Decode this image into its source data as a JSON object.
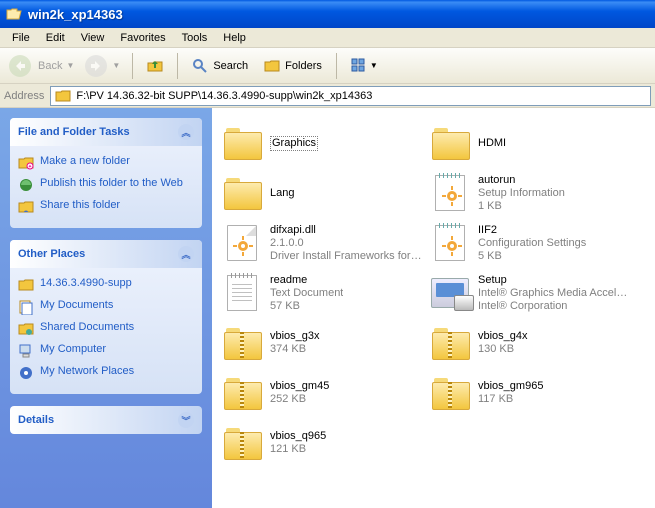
{
  "window": {
    "title": "win2k_xp14363"
  },
  "menu": {
    "file": "File",
    "edit": "Edit",
    "view": "View",
    "favorites": "Favorites",
    "tools": "Tools",
    "help": "Help"
  },
  "toolbar": {
    "back": "Back",
    "search": "Search",
    "folders": "Folders"
  },
  "address": {
    "label": "Address",
    "path": "F:\\PV 14.36.32-bit SUPP\\14.36.3.4990-supp\\win2k_xp14363"
  },
  "panels": {
    "tasks": {
      "title": "File and Folder Tasks",
      "items": [
        {
          "label": "Make a new folder"
        },
        {
          "label": "Publish this folder to the Web"
        },
        {
          "label": "Share this folder"
        }
      ]
    },
    "places": {
      "title": "Other Places",
      "items": [
        {
          "label": "14.36.3.4990-supp"
        },
        {
          "label": "My Documents"
        },
        {
          "label": "Shared Documents"
        },
        {
          "label": "My Computer"
        },
        {
          "label": "My Network Places"
        }
      ]
    },
    "details": {
      "title": "Details"
    }
  },
  "files": [
    {
      "name": "Graphics",
      "type": "folder",
      "selected": true
    },
    {
      "name": "Lang",
      "type": "folder"
    },
    {
      "name": "difxapi.dll",
      "type": "dll",
      "sub1": "2.1.0.0",
      "sub2": "Driver Install Frameworks for ..."
    },
    {
      "name": "readme",
      "type": "txt",
      "sub1": "Text Document",
      "sub2": "57 KB"
    },
    {
      "name": "vbios_g3x",
      "type": "zip",
      "sub1": "374 KB"
    },
    {
      "name": "vbios_gm45",
      "type": "zip",
      "sub1": "252 KB"
    },
    {
      "name": "vbios_q965",
      "type": "zip",
      "sub1": "121 KB"
    },
    {
      "name": "HDMI",
      "type": "folder"
    },
    {
      "name": "autorun",
      "type": "ini",
      "sub1": "Setup Information",
      "sub2": "1 KB"
    },
    {
      "name": "IIF2",
      "type": "ini",
      "sub1": "Configuration Settings",
      "sub2": "5 KB"
    },
    {
      "name": "Setup",
      "type": "setup",
      "sub1": "Intel® Graphics Media Acceler...",
      "sub2": "Intel® Corporation"
    },
    {
      "name": "vbios_g4x",
      "type": "zip",
      "sub1": "130 KB"
    },
    {
      "name": "vbios_gm965",
      "type": "zip",
      "sub1": "117 KB"
    }
  ]
}
